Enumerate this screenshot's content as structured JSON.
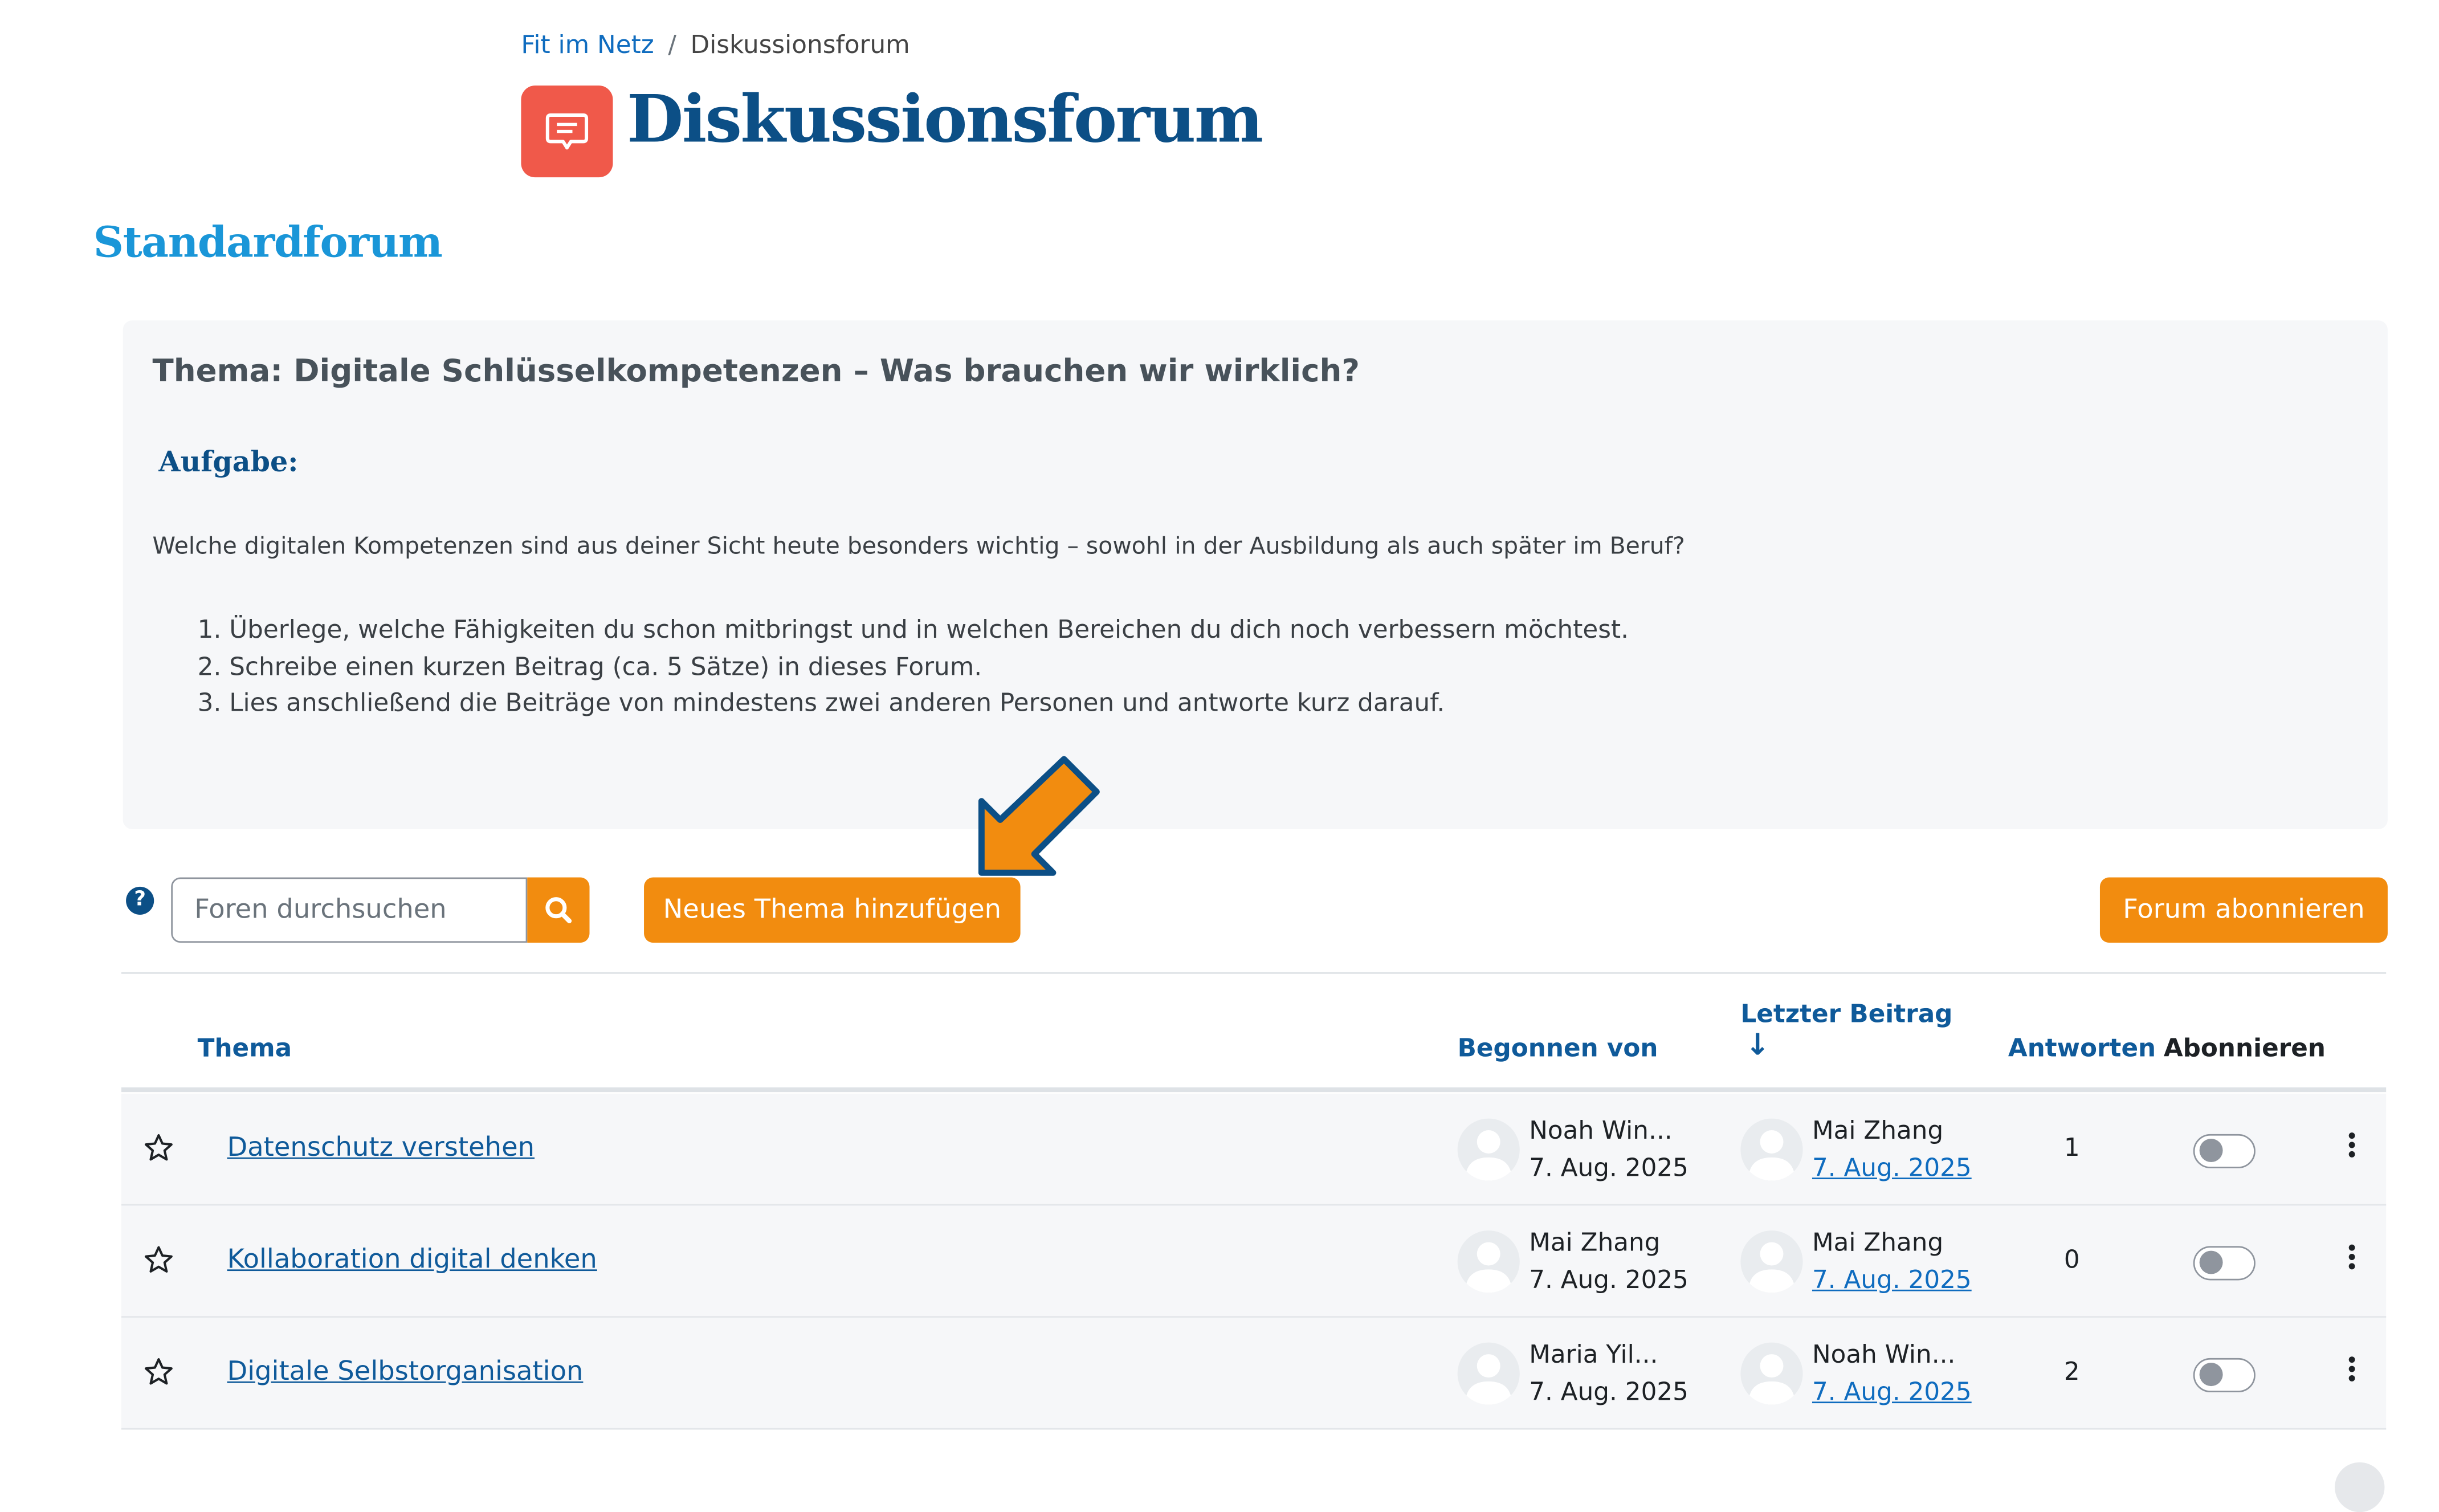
{
  "breadcrumb": {
    "home": "Fit im Netz",
    "separator": "/",
    "current": "Diskussionsforum"
  },
  "page": {
    "title": "Diskussionsforum",
    "forum_type": "Standardforum"
  },
  "intro": {
    "title": "Thema: Digitale Schlüsselkompetenzen – Was brauchen wir wirklich?",
    "task_label": "Aufgabe:",
    "question": "Welche digitalen Kompetenzen sind aus deiner Sicht heute besonders wichtig – sowohl in der Ausbildung als auch später im Beruf?",
    "steps": [
      "1. Überlege, welche Fähigkeiten du schon mitbringst und in welchen Bereichen du dich noch verbessern möchtest.",
      "2. Schreibe einen kurzen Beitrag (ca. 5 Sätze) in dieses Forum.",
      "3. Lies anschließend die Beiträge von mindestens zwei anderen Personen und antworte kurz darauf."
    ]
  },
  "toolbar": {
    "help": "?",
    "search_placeholder": "Foren durchsuchen",
    "add_topic_label": "Neues Thema hinzufügen",
    "subscribe_label": "Forum abonnieren"
  },
  "table": {
    "headers": {
      "topic": "Thema",
      "started_by": "Begonnen von",
      "last_post": "Letzter Beitrag",
      "sort_arrow": "↓",
      "replies": "Antworten",
      "subscribe": "Abonnieren"
    },
    "rows": [
      {
        "topic": "Datenschutz verstehen",
        "started_by": "Noah Win...",
        "started_date": "7. Aug. 2025",
        "last_by": "Mai Zhang",
        "last_date": "7. Aug. 2025",
        "replies": "1",
        "subscribed": false
      },
      {
        "topic": "Kollaboration digital denken",
        "started_by": "Mai Zhang",
        "started_date": "7. Aug. 2025",
        "last_by": "Mai Zhang",
        "last_date": "7. Aug. 2025",
        "replies": "0",
        "subscribed": false
      },
      {
        "topic": "Digitale Selbstorganisation",
        "started_by": "Maria Yil...",
        "started_date": "7. Aug. 2025",
        "last_by": "Noah Win...",
        "last_date": "7. Aug. 2025",
        "replies": "2",
        "subscribed": false
      }
    ]
  },
  "icons": {
    "forum": "chat-bubble-icon",
    "search": "search-icon",
    "star": "star-outline-icon",
    "menu": "kebab-menu-icon",
    "avatar": "default-user-avatar",
    "pointer": "orange-arrow-icon"
  },
  "colors": {
    "accent": "#f28c0f",
    "heading": "#0c4f86",
    "forum_type": "#1a96d8",
    "forum_icon_bg": "#f0594a",
    "link": "#0f6cbf"
  }
}
